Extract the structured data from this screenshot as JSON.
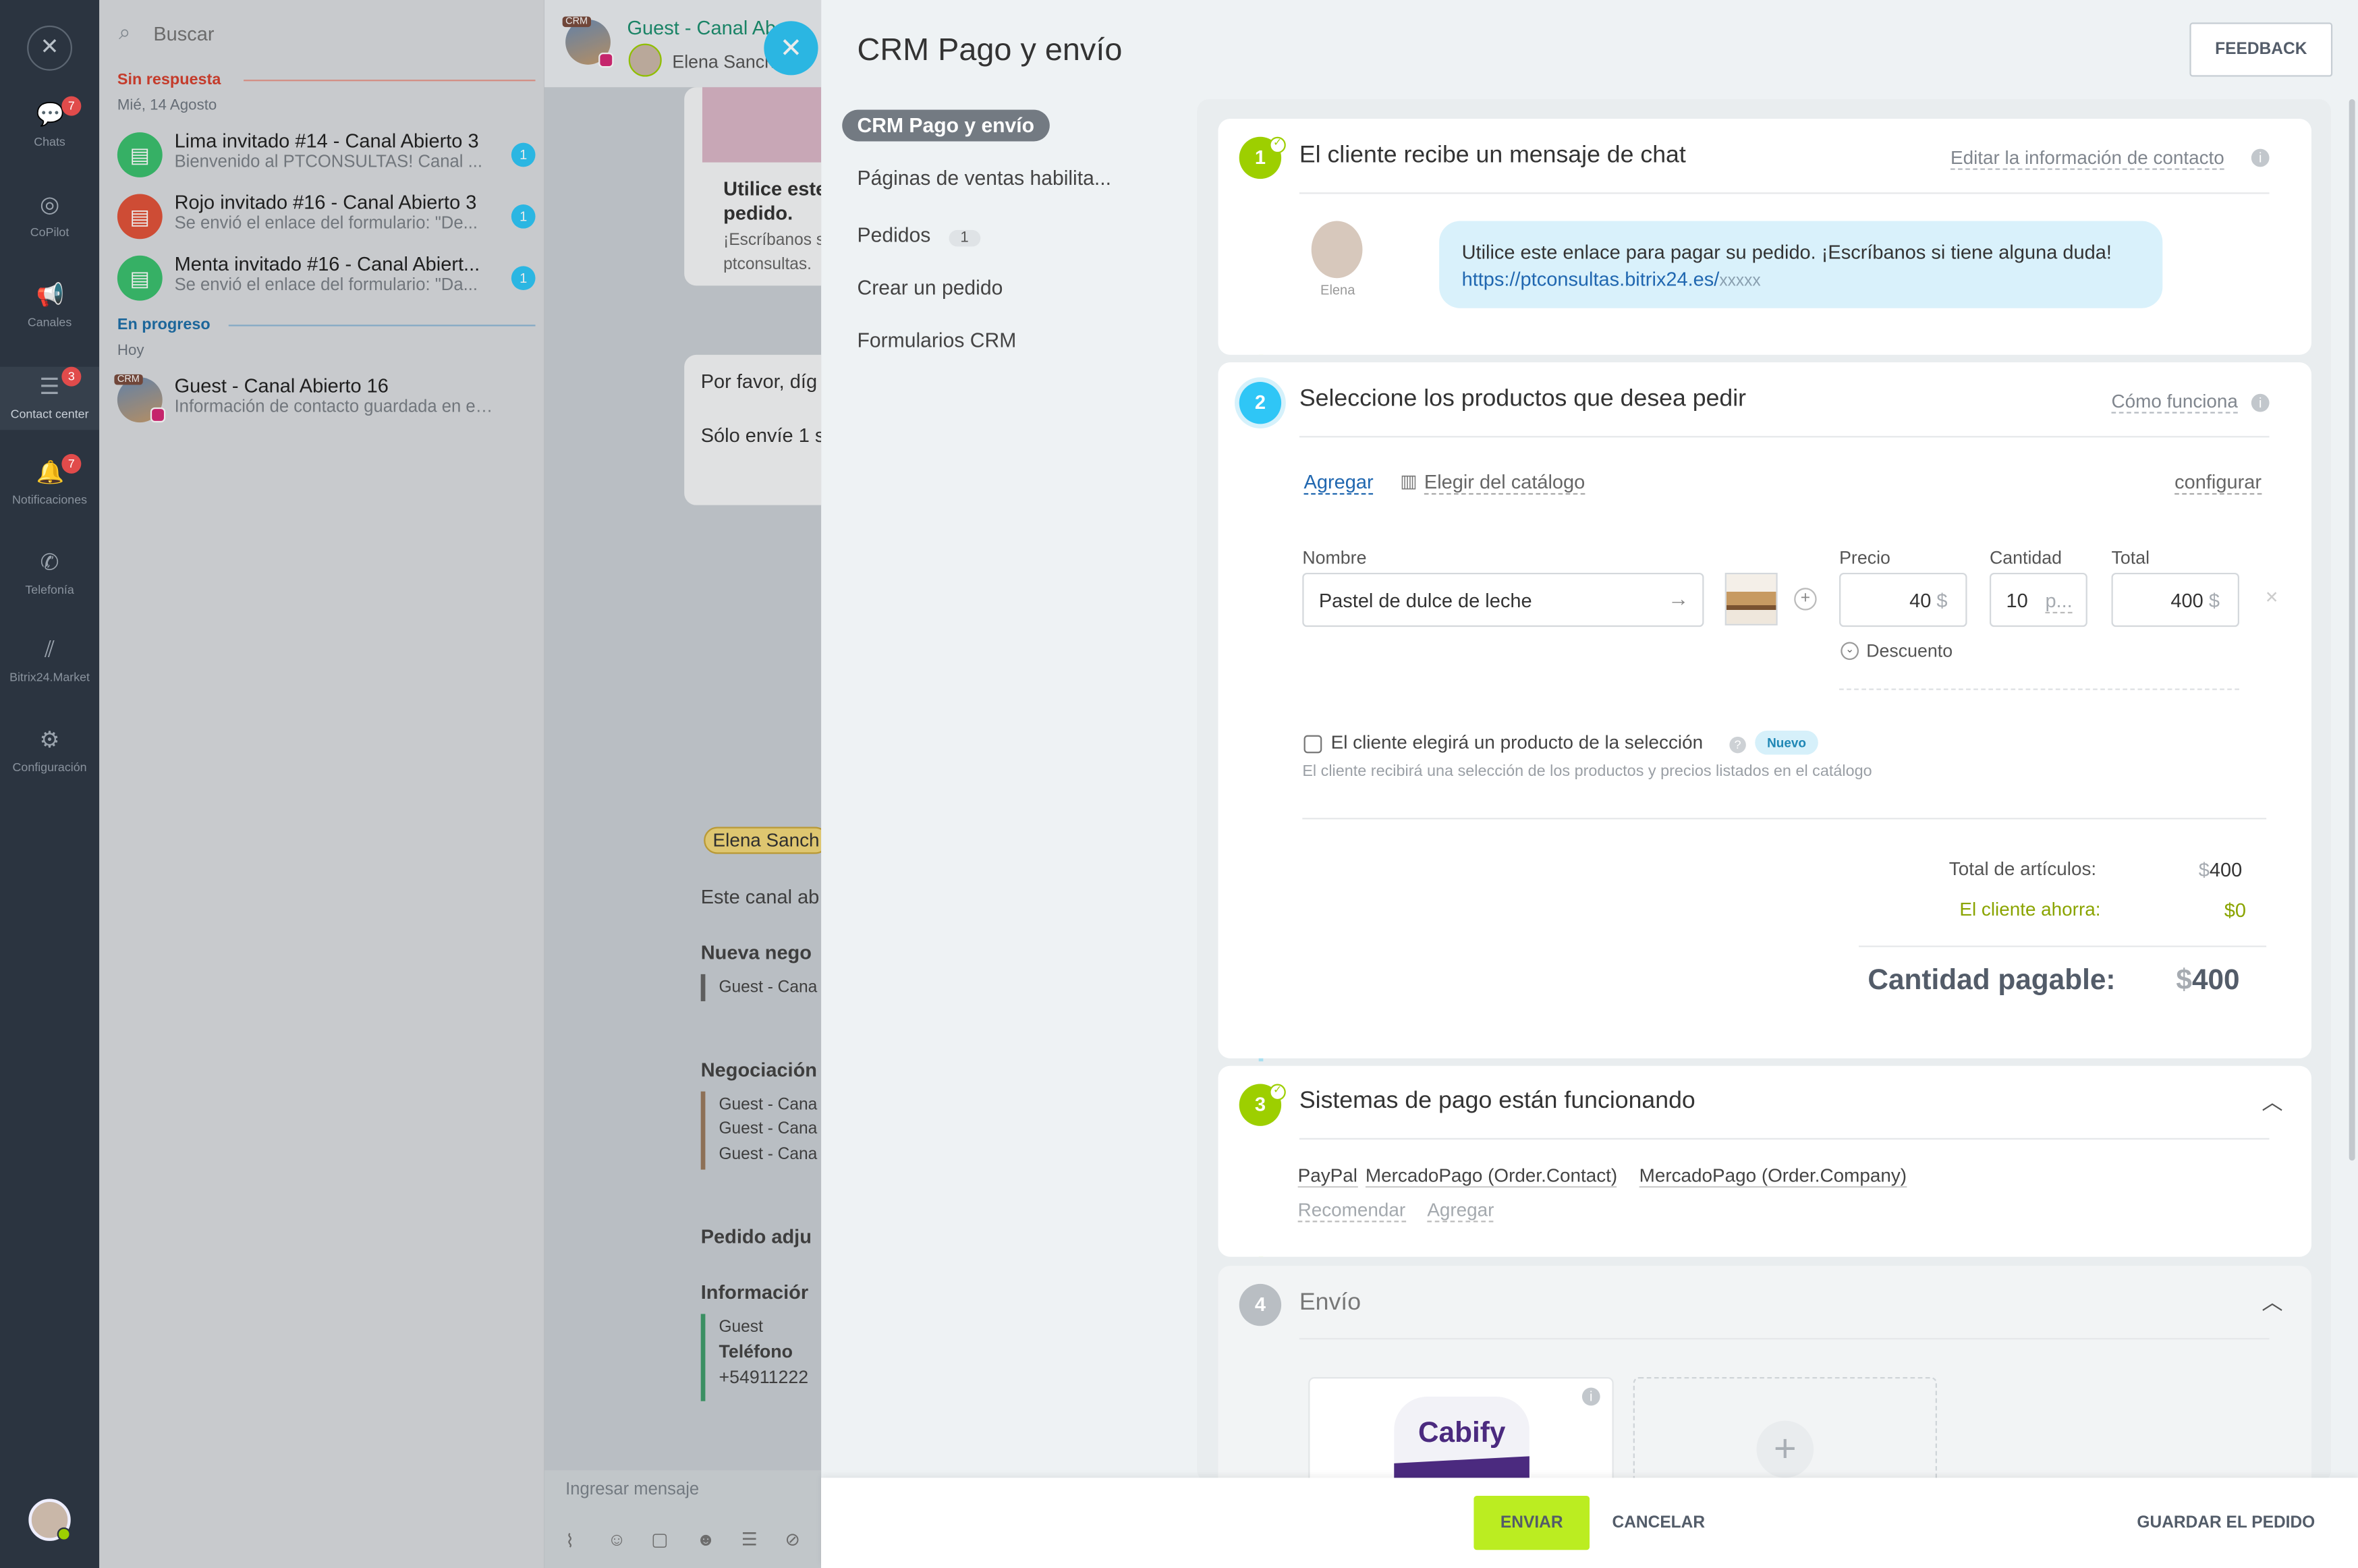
{
  "rail": {
    "items": [
      {
        "label": "Chats",
        "badge": "7"
      },
      {
        "label": "CoPilot",
        "badge": ""
      },
      {
        "label": "Canales",
        "badge": ""
      },
      {
        "label": "Contact center",
        "badge": "3"
      },
      {
        "label": "Notificaciones",
        "badge": "7"
      },
      {
        "label": "Telefonía",
        "badge": ""
      },
      {
        "label": "Bitrix24.Market",
        "badge": ""
      },
      {
        "label": "Configuración",
        "badge": ""
      }
    ]
  },
  "chatlist": {
    "search_placeholder": "Buscar",
    "group_unanswered": "Sin respuesta",
    "date_unanswered": "Mié, 14 Agosto",
    "group_progress": "En progreso",
    "date_progress": "Hoy",
    "chats": [
      {
        "title": "Lima invitado #14 - Canal Abierto 3",
        "snippet": "Bienvenido al PTCONSULTAS! Canal ...",
        "count": "1",
        "color": "#3bbf6e"
      },
      {
        "title": "Rojo invitado #16 - Canal Abierto 3",
        "snippet": "Se envió el enlace del formulario: \"De...",
        "count": "1",
        "color": "#e0533a"
      },
      {
        "title": "Menta invitado #16 - Canal Abiert...",
        "snippet": "Se envió el enlace del formulario: \"Da...",
        "count": "1",
        "color": "#3bbf6e"
      },
      {
        "title": "Guest - Canal Abierto 16",
        "snippet": "Información de contacto guardada en el c...",
        "count": "",
        "color": "#6b8db5"
      }
    ],
    "crm_tag": "CRM"
  },
  "midchat": {
    "header_title": "Guest - Canal Ab",
    "header_user": "Elena Sanch",
    "card_bold_1": "Utilice este",
    "card_bold_2": "pedido.",
    "card_small_1": "¡Escríbanos s",
    "card_small_2": "ptconsultas.",
    "msg_1": "Por favor, díg",
    "msg_2": "Sólo envíe 1 s",
    "name_tag": "Elena Sanch",
    "line_1": "Este canal ab",
    "sec_1": "Nueva nego",
    "sec_1_item": "Guest - Cana",
    "sec_2": "Negociación",
    "sec_2_items": [
      "Guest - Cana",
      "Guest - Cana",
      "Guest - Cana"
    ],
    "sec_3": "Pedido adju",
    "sec_4": "Informaciór",
    "info_1": "Guest",
    "info_2": "Teléfono",
    "info_3": "+54911222",
    "input_placeholder": "Ingresar mensaje"
  },
  "panel": {
    "title": "CRM Pago y envío",
    "feedback": "FEEDBACK",
    "nav": [
      {
        "label": "CRM Pago y envío"
      },
      {
        "label": "Páginas de ventas habilita..."
      },
      {
        "label": "Pedidos",
        "count": "1"
      },
      {
        "label": "Crear un pedido"
      },
      {
        "label": "Formularios CRM"
      }
    ],
    "step1": {
      "num": "1",
      "title": "El cliente recibe un mensaje de chat",
      "link": "Editar la información de contacto",
      "avatar_name": "Elena",
      "message": "Utilice este enlace para pagar su pedido. ¡Escríbanos si tiene alguna duda!",
      "url": "https://ptconsultas.bitrix24.es/",
      "url_tail": "xxxxx"
    },
    "step2": {
      "num": "2",
      "title": "Seleccione los productos que desea pedir",
      "link": "Cómo funciona",
      "add": "Agregar",
      "catalog": "Elegir del catálogo",
      "configure": "configurar",
      "col_name": "Nombre",
      "col_price": "Precio",
      "col_qty": "Cantidad",
      "col_total": "Total",
      "product_name": "Pastel de dulce de leche",
      "price": "40",
      "qty": "10",
      "qty_unit": "p...",
      "total": "400",
      "currency": "$",
      "discount": "Descuento",
      "choice_label": "El cliente elegirá un producto de la selección",
      "new_badge": "Nuevo",
      "choice_hint": "El cliente recibirá una selección de los productos y precios listados en el catálogo",
      "items_total_label": "Total de artículos:",
      "items_total": "400",
      "saves_label": "El cliente ahorra:",
      "saves": "0",
      "payable_label": "Cantidad pagable:",
      "payable": "400"
    },
    "step3": {
      "num": "3",
      "title": "Sistemas de pago están funcionando",
      "systems": [
        "PayPal",
        "MercadoPago (Order.Contact)",
        "MercadoPago (Order.Company)"
      ],
      "recommend": "Recomendar",
      "add": "Agregar"
    },
    "step4": {
      "num": "4",
      "title": "Envío",
      "service": "Cabify"
    },
    "footer": {
      "send": "ENVIAR",
      "cancel": "CANCELAR",
      "save": "GUARDAR EL PEDIDO"
    }
  },
  "colors": {
    "accent_blue": "#2fc6f6",
    "green": "#9dcf00",
    "link": "#2067b0",
    "step2_line": "#a8dff0"
  }
}
